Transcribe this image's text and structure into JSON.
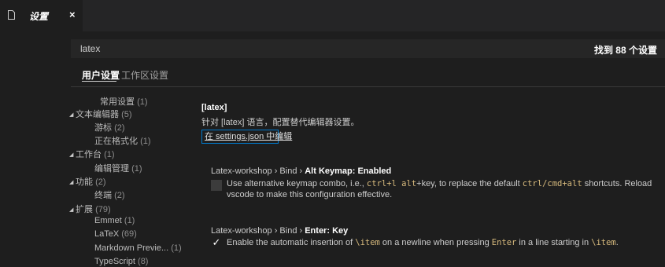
{
  "tab": {
    "title": "设置",
    "close": "×"
  },
  "search": {
    "value": "latex",
    "placeholder": "",
    "result_count": "找到 88 个设置"
  },
  "settings_tabs": {
    "user": "用户设置",
    "workspace": "工作区设置"
  },
  "toc": [
    {
      "label": "常用设置",
      "count": "(1)",
      "caret": ""
    },
    {
      "label": "文本编辑器",
      "count": "(5)",
      "caret": "◢"
    },
    {
      "label": "游标",
      "count": "(2)",
      "caret": ""
    },
    {
      "label": "正在格式化",
      "count": "(1)",
      "caret": ""
    },
    {
      "label": "工作台",
      "count": "(1)",
      "caret": "◢"
    },
    {
      "label": "编辑管理",
      "count": "(1)",
      "caret": ""
    },
    {
      "label": "功能",
      "count": "(2)",
      "caret": "◢"
    },
    {
      "label": "终端",
      "count": "(2)",
      "caret": ""
    },
    {
      "label": "扩展",
      "count": "(79)",
      "caret": "◢"
    },
    {
      "label": "Emmet",
      "count": "(1)",
      "caret": ""
    },
    {
      "label": "LaTeX",
      "count": "(69)",
      "caret": ""
    },
    {
      "label": "Markdown Previe...",
      "count": "(1)",
      "caret": ""
    },
    {
      "label": "TypeScript",
      "count": "(8)",
      "caret": ""
    }
  ],
  "section": {
    "title": "[latex]",
    "description": "针对 [latex] 语言，配置替代编辑器设置。",
    "edit_link": "在 settings.json 中编辑"
  },
  "settings": [
    {
      "title_prefix": "Latex-workshop › Bind › ",
      "title_name": "Alt Keymap:",
      "title_value": "Enabled",
      "checked": false,
      "desc": {
        "p1": "Use alternative keymap combo, i.e., ",
        "c1": "ctrl+l alt",
        "p2": "+key, to replace the default ",
        "c2": "ctrl/cmd+alt",
        "p3": " shortcuts. Reload vscode to make this configuration effective."
      }
    },
    {
      "title_prefix": "Latex-workshop › Bind › ",
      "title_name": "Enter:",
      "title_value": "Key",
      "checked": true,
      "check_glyph": "✓",
      "desc": {
        "p1": "Enable the automatic insertion of ",
        "c1": "\\item",
        "p2": " on a newline when pressing ",
        "c2": "Enter",
        "p3": " in a line starting in ",
        "c3": "\\item",
        "p4": "."
      }
    }
  ],
  "colors": {
    "background": "#1e1e1e",
    "accent": "#007acc",
    "code": "#d7ba7d"
  }
}
